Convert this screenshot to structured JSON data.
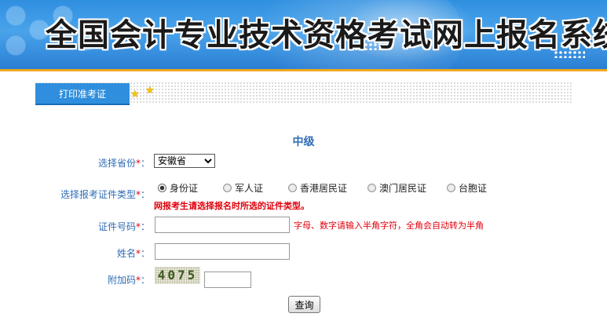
{
  "header": {
    "title": "全国会计专业技术资格考试网上报名系统"
  },
  "tabs": {
    "active_label": "打印准考证"
  },
  "form": {
    "section_title": "中级",
    "province": {
      "label": "选择省份",
      "required_mark": "*",
      "suffix": "：",
      "selected_value": "安徽省"
    },
    "id_type": {
      "label": "选择报考证件类型",
      "required_mark": "*",
      "suffix": "：",
      "options": [
        "身份证",
        "军人证",
        "香港居民证",
        "澳门居民证",
        "台胞证"
      ],
      "selected": "身份证",
      "warning": "网报考生请选择报名时所选的证件类型。"
    },
    "id_number": {
      "label": "证件号码",
      "required_mark": "*",
      "suffix": "：",
      "value": "",
      "hint": "字母、数字请输入半角字符，全角会自动转为半角"
    },
    "name": {
      "label": "姓名",
      "required_mark": "*",
      "suffix": "：",
      "value": ""
    },
    "captcha": {
      "label": "附加码",
      "required_mark": "*",
      "suffix": "：",
      "image_text": "4075",
      "value": ""
    },
    "submit_label": "查询"
  },
  "colors": {
    "banner_blue": "#2f8fe0",
    "accent_orange": "#f1a81f",
    "label_blue": "#2f6db5",
    "warning_red": "#e0000b"
  }
}
